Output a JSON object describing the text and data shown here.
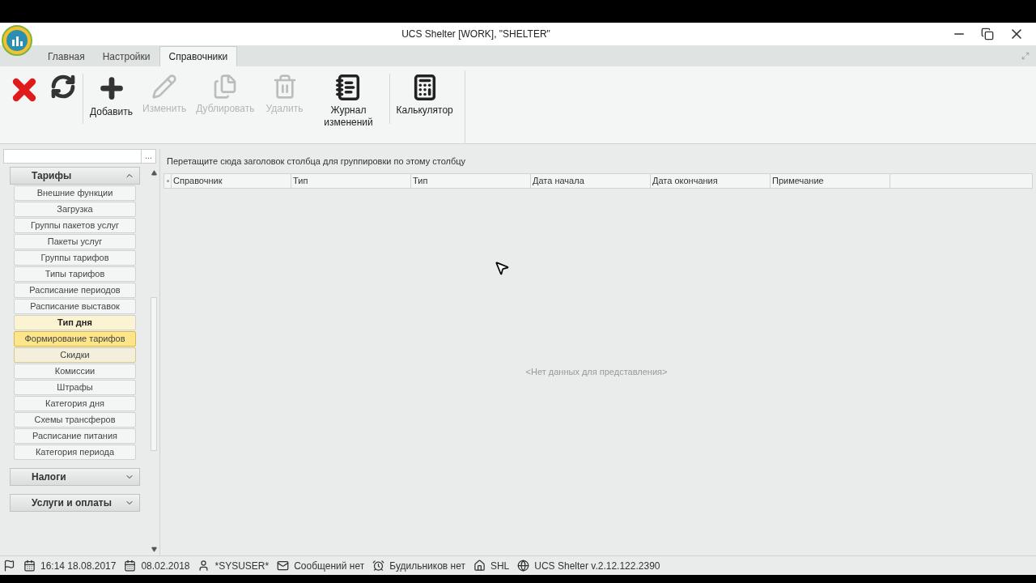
{
  "window": {
    "title": "UCS Shelter [WORK], \"SHELTER\""
  },
  "tabs": [
    {
      "label": "Главная",
      "selected": false
    },
    {
      "label": "Настройки",
      "selected": false
    },
    {
      "label": "Справочники",
      "selected": true
    }
  ],
  "toolbar": [
    {
      "kind": "close",
      "disabled": false
    },
    {
      "kind": "refresh",
      "disabled": false
    },
    {
      "kind": "add",
      "label": "Добавить",
      "disabled": false
    },
    {
      "kind": "edit",
      "label": "Изменить",
      "disabled": true
    },
    {
      "kind": "duplicate",
      "label": "Дублировать",
      "disabled": true
    },
    {
      "kind": "delete",
      "label": "Удалить",
      "disabled": true
    },
    {
      "kind": "journal",
      "label": "Журнал изменений",
      "disabled": false
    },
    {
      "kind": "calculator",
      "label": "Калькулятор",
      "disabled": false
    }
  ],
  "sidebar": {
    "search_button": "...",
    "groups": [
      {
        "title": "Тарифы",
        "expanded": true,
        "items": [
          {
            "label": "Внешние функции",
            "current": false,
            "selected": false,
            "hovered": false
          },
          {
            "label": "Загрузка",
            "current": false,
            "selected": false,
            "hovered": false
          },
          {
            "label": "Группы пакетов услуг",
            "current": false,
            "selected": false,
            "hovered": false
          },
          {
            "label": "Пакеты услуг",
            "current": false,
            "selected": false,
            "hovered": false
          },
          {
            "label": "Группы тарифов",
            "current": false,
            "selected": false,
            "hovered": false
          },
          {
            "label": "Типы тарифов",
            "current": false,
            "selected": false,
            "hovered": false
          },
          {
            "label": "Расписание периодов",
            "current": false,
            "selected": false,
            "hovered": false
          },
          {
            "label": "Расписание выставок",
            "current": false,
            "selected": false,
            "hovered": false
          },
          {
            "label": "Тип дня",
            "current": true,
            "selected": false,
            "hovered": false
          },
          {
            "label": "Формирование тарифов",
            "current": false,
            "selected": true,
            "hovered": false
          },
          {
            "label": "Скидки",
            "current": false,
            "selected": false,
            "hovered": true
          },
          {
            "label": "Комиссии",
            "current": false,
            "selected": false,
            "hovered": false
          },
          {
            "label": "Штрафы",
            "current": false,
            "selected": false,
            "hovered": false
          },
          {
            "label": "Категория дня",
            "current": false,
            "selected": false,
            "hovered": false
          },
          {
            "label": "Схемы трансферов",
            "current": false,
            "selected": false,
            "hovered": false
          },
          {
            "label": "Расписание питания",
            "current": false,
            "selected": false,
            "hovered": false
          },
          {
            "label": "Категория периода",
            "current": false,
            "selected": false,
            "hovered": false
          }
        ]
      },
      {
        "title": "Налоги",
        "expanded": false
      },
      {
        "title": "Услуги и оплаты",
        "expanded": false
      }
    ]
  },
  "grid": {
    "group_hint": "Перетащите сюда заголовок столбца для группировки по этому столбцу",
    "columns": [
      "Справочник",
      "Тип",
      "Тип",
      "Дата начала",
      "Дата окончания",
      "Примечание"
    ],
    "empty_text": "<Нет данных для представления>"
  },
  "status_bar": [
    {
      "kind": "flag"
    },
    {
      "kind": "calendar",
      "text": "16:14 18.08.2017"
    },
    {
      "kind": "calendar",
      "text": "08.02.2018"
    },
    {
      "kind": "user",
      "text": "*SYSUSER*"
    },
    {
      "kind": "mail",
      "text": "Сообщений нет"
    },
    {
      "kind": "alarm",
      "text": "Будильников нет"
    },
    {
      "kind": "home",
      "text": "SHL"
    },
    {
      "kind": "globe",
      "text": "UCS Shelter v.2.12.122.2390"
    }
  ]
}
